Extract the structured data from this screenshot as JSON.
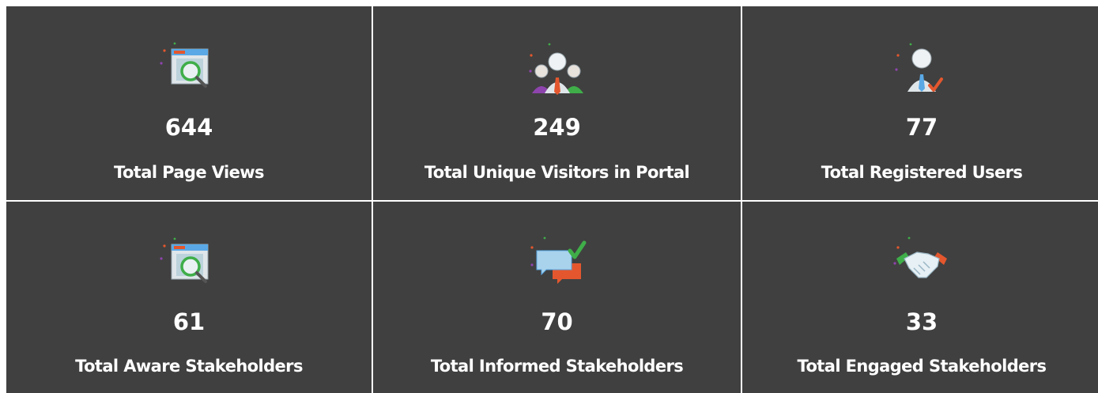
{
  "tiles": [
    {
      "value": "644",
      "label": "Total Page Views",
      "icon": "browser-search-icon"
    },
    {
      "value": "249",
      "label": "Total Unique Visitors in Portal",
      "icon": "visitors-group-icon"
    },
    {
      "value": "77",
      "label": "Total Registered Users",
      "icon": "registered-user-icon"
    },
    {
      "value": "61",
      "label": "Total Aware Stakeholders",
      "icon": "browser-search-icon"
    },
    {
      "value": "70",
      "label": "Total Informed Stakeholders",
      "icon": "chat-check-icon"
    },
    {
      "value": "33",
      "label": "Total Engaged Stakeholders",
      "icon": "handshake-icon"
    }
  ],
  "colors": {
    "tile_background": "#404040",
    "text": "#ffffff",
    "accent_green": "#3fae49",
    "accent_red": "#e4572e",
    "accent_purple": "#8e44ad",
    "accent_blue": "#5aa9e6"
  }
}
